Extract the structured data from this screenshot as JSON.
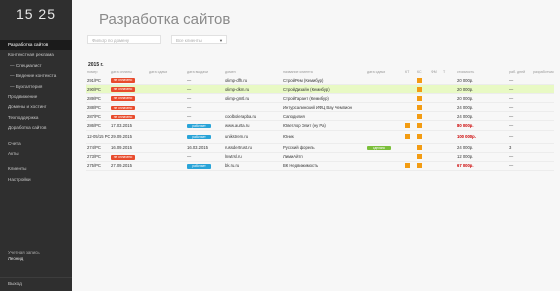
{
  "clock": "15 25",
  "sidebar": {
    "items": [
      {
        "label": "Разработка сайтов",
        "active": true,
        "sub": false
      },
      {
        "label": "Контекстная реклама",
        "active": false,
        "sub": false
      },
      {
        "label": "— Специалист",
        "active": false,
        "sub": true
      },
      {
        "label": "— Ведение контекста",
        "active": false,
        "sub": true
      },
      {
        "label": "— Бухгалтерия",
        "active": false,
        "sub": true
      },
      {
        "label": "Продвижение",
        "active": false,
        "sub": false
      },
      {
        "label": "Домены и хостинг",
        "active": false,
        "sub": false
      },
      {
        "label": "Техподдержка",
        "active": false,
        "sub": false
      },
      {
        "label": "Доработка сайтов",
        "active": false,
        "sub": false
      }
    ],
    "items2": [
      {
        "label": "Счета"
      },
      {
        "label": "Акты"
      }
    ],
    "items3": [
      {
        "label": "Клиенты"
      },
      {
        "label": "Настройки"
      }
    ],
    "user_label": "Учетная запись",
    "user_name": "Леонид",
    "exit": "Выход"
  },
  "page": {
    "title": "Разработка сайтов",
    "filter_domain_placeholder": "Фильтр по домену",
    "filter_client": "Все клиенты",
    "filter_arrow": "▼",
    "year": "2015 г."
  },
  "table": {
    "headers": [
      "номер",
      "дата оплаты",
      "дата сдачи",
      "дата выдачи",
      "домен",
      "название клиента",
      "дата сдачи",
      "КТ",
      "КС",
      "ФМ",
      "Т",
      "стоимость",
      "раб. дней",
      "разработчик"
    ],
    "rows": [
      {
        "num": "291/РС",
        "status": "не оплачено",
        "status_color": "red",
        "delivery": "—",
        "domain": "olimp-dfh.ru",
        "client": "СтройРем (Кемибур)",
        "extra_status": "",
        "kt": false,
        "ks": true,
        "price": "20 000р.",
        "price_red": false,
        "days": "—",
        "hl": false,
        "two": false
      },
      {
        "num": "290/РС",
        "status": "не оплачено",
        "status_color": "red",
        "delivery": "—",
        "domain": "olimp-dkm.ru",
        "client": "СтройДизайн (Кемибур)",
        "extra_status": "",
        "kt": false,
        "ks": true,
        "price": "20 000р.",
        "price_red": false,
        "days": "—",
        "hl": true,
        "two": false
      },
      {
        "num": "289/РС",
        "status": "не оплачено",
        "status_color": "red",
        "delivery": "—",
        "domain": "olimp-gmtl.ru",
        "client": "СтройГарант (Кемибур)",
        "extra_status": "",
        "kt": false,
        "ks": true,
        "price": "20 000р.",
        "price_red": false,
        "days": "—",
        "hl": false,
        "two": false
      },
      {
        "num": "288/РС",
        "status": "не оплачено",
        "status_color": "red",
        "delivery": "—",
        "domain": "",
        "client": "Интурсалинский ИФЦ Вау Чемпион",
        "extra_status": "",
        "kt": false,
        "ks": true,
        "price": "24 000р.",
        "price_red": false,
        "days": "—",
        "hl": false,
        "two": false
      },
      {
        "num": "287/РС",
        "status": "не оплачено",
        "status_color": "red",
        "delivery": "—",
        "domain": "coolbolerapba.ru",
        "client": "Саподилия",
        "extra_status": "",
        "kt": false,
        "ks": true,
        "price": "24 000р.",
        "price_red": false,
        "days": "—",
        "hl": false,
        "two": false
      },
      {
        "num": "286/РС",
        "status": "17.03.2015",
        "status_color": "",
        "delivery": "работает",
        "domain": "www.aurta.ru",
        "client": "Юветлор Элит (ну Ра)",
        "extra_status": "",
        "kt": true,
        "ks": true,
        "price": "80 000р.",
        "price_red": true,
        "days": "—",
        "hl": false,
        "two": false
      },
      {
        "num": "12-05/15 РС",
        "status": "29.09.2015",
        "status_color": "",
        "delivery": "работает",
        "domain": "unikstrem.ru",
        "client": "Юник",
        "extra_status": "",
        "kt": true,
        "ks": true,
        "price": "100 000р.",
        "price_red": true,
        "days": "—",
        "hl": false,
        "two": true
      },
      {
        "num": "274/РС",
        "status": "16.09.2015",
        "status_color": "",
        "delivery": "16.03.2015",
        "domain": "russdertrust.ru",
        "client": "Русский форель",
        "extra_status": "сделано",
        "kt": false,
        "ks": true,
        "price": "24 000р.",
        "price_red": false,
        "days": "3",
        "hl": false,
        "two": false
      },
      {
        "num": "273/РС",
        "status": "не оплачено",
        "status_color": "red",
        "delivery": "—",
        "domain": "lnwtrsl.ru",
        "client": "ЛимиАйтп",
        "extra_status": "",
        "kt": false,
        "ks": true,
        "price": "12 000р.",
        "price_red": false,
        "days": "—",
        "hl": false,
        "two": false
      },
      {
        "num": "275/РС",
        "status": "27.09.2015",
        "status_color": "",
        "delivery": "работает",
        "domain": "bk.ru.ru",
        "client": "ВК Недвижимость",
        "extra_status": "",
        "kt": true,
        "ks": true,
        "price": "67 000р.",
        "price_red": true,
        "days": "—",
        "hl": false,
        "two": false
      }
    ]
  },
  "colors": {
    "sidebar_bg": "#2f2f2f",
    "active_item": "#1b1b1b",
    "highlight_row": "#e8f9c4",
    "status_red": "#e84b2c",
    "status_blue": "#29a4d8",
    "status_green": "#7bbf3a",
    "marker_orange": "#f39c12"
  }
}
